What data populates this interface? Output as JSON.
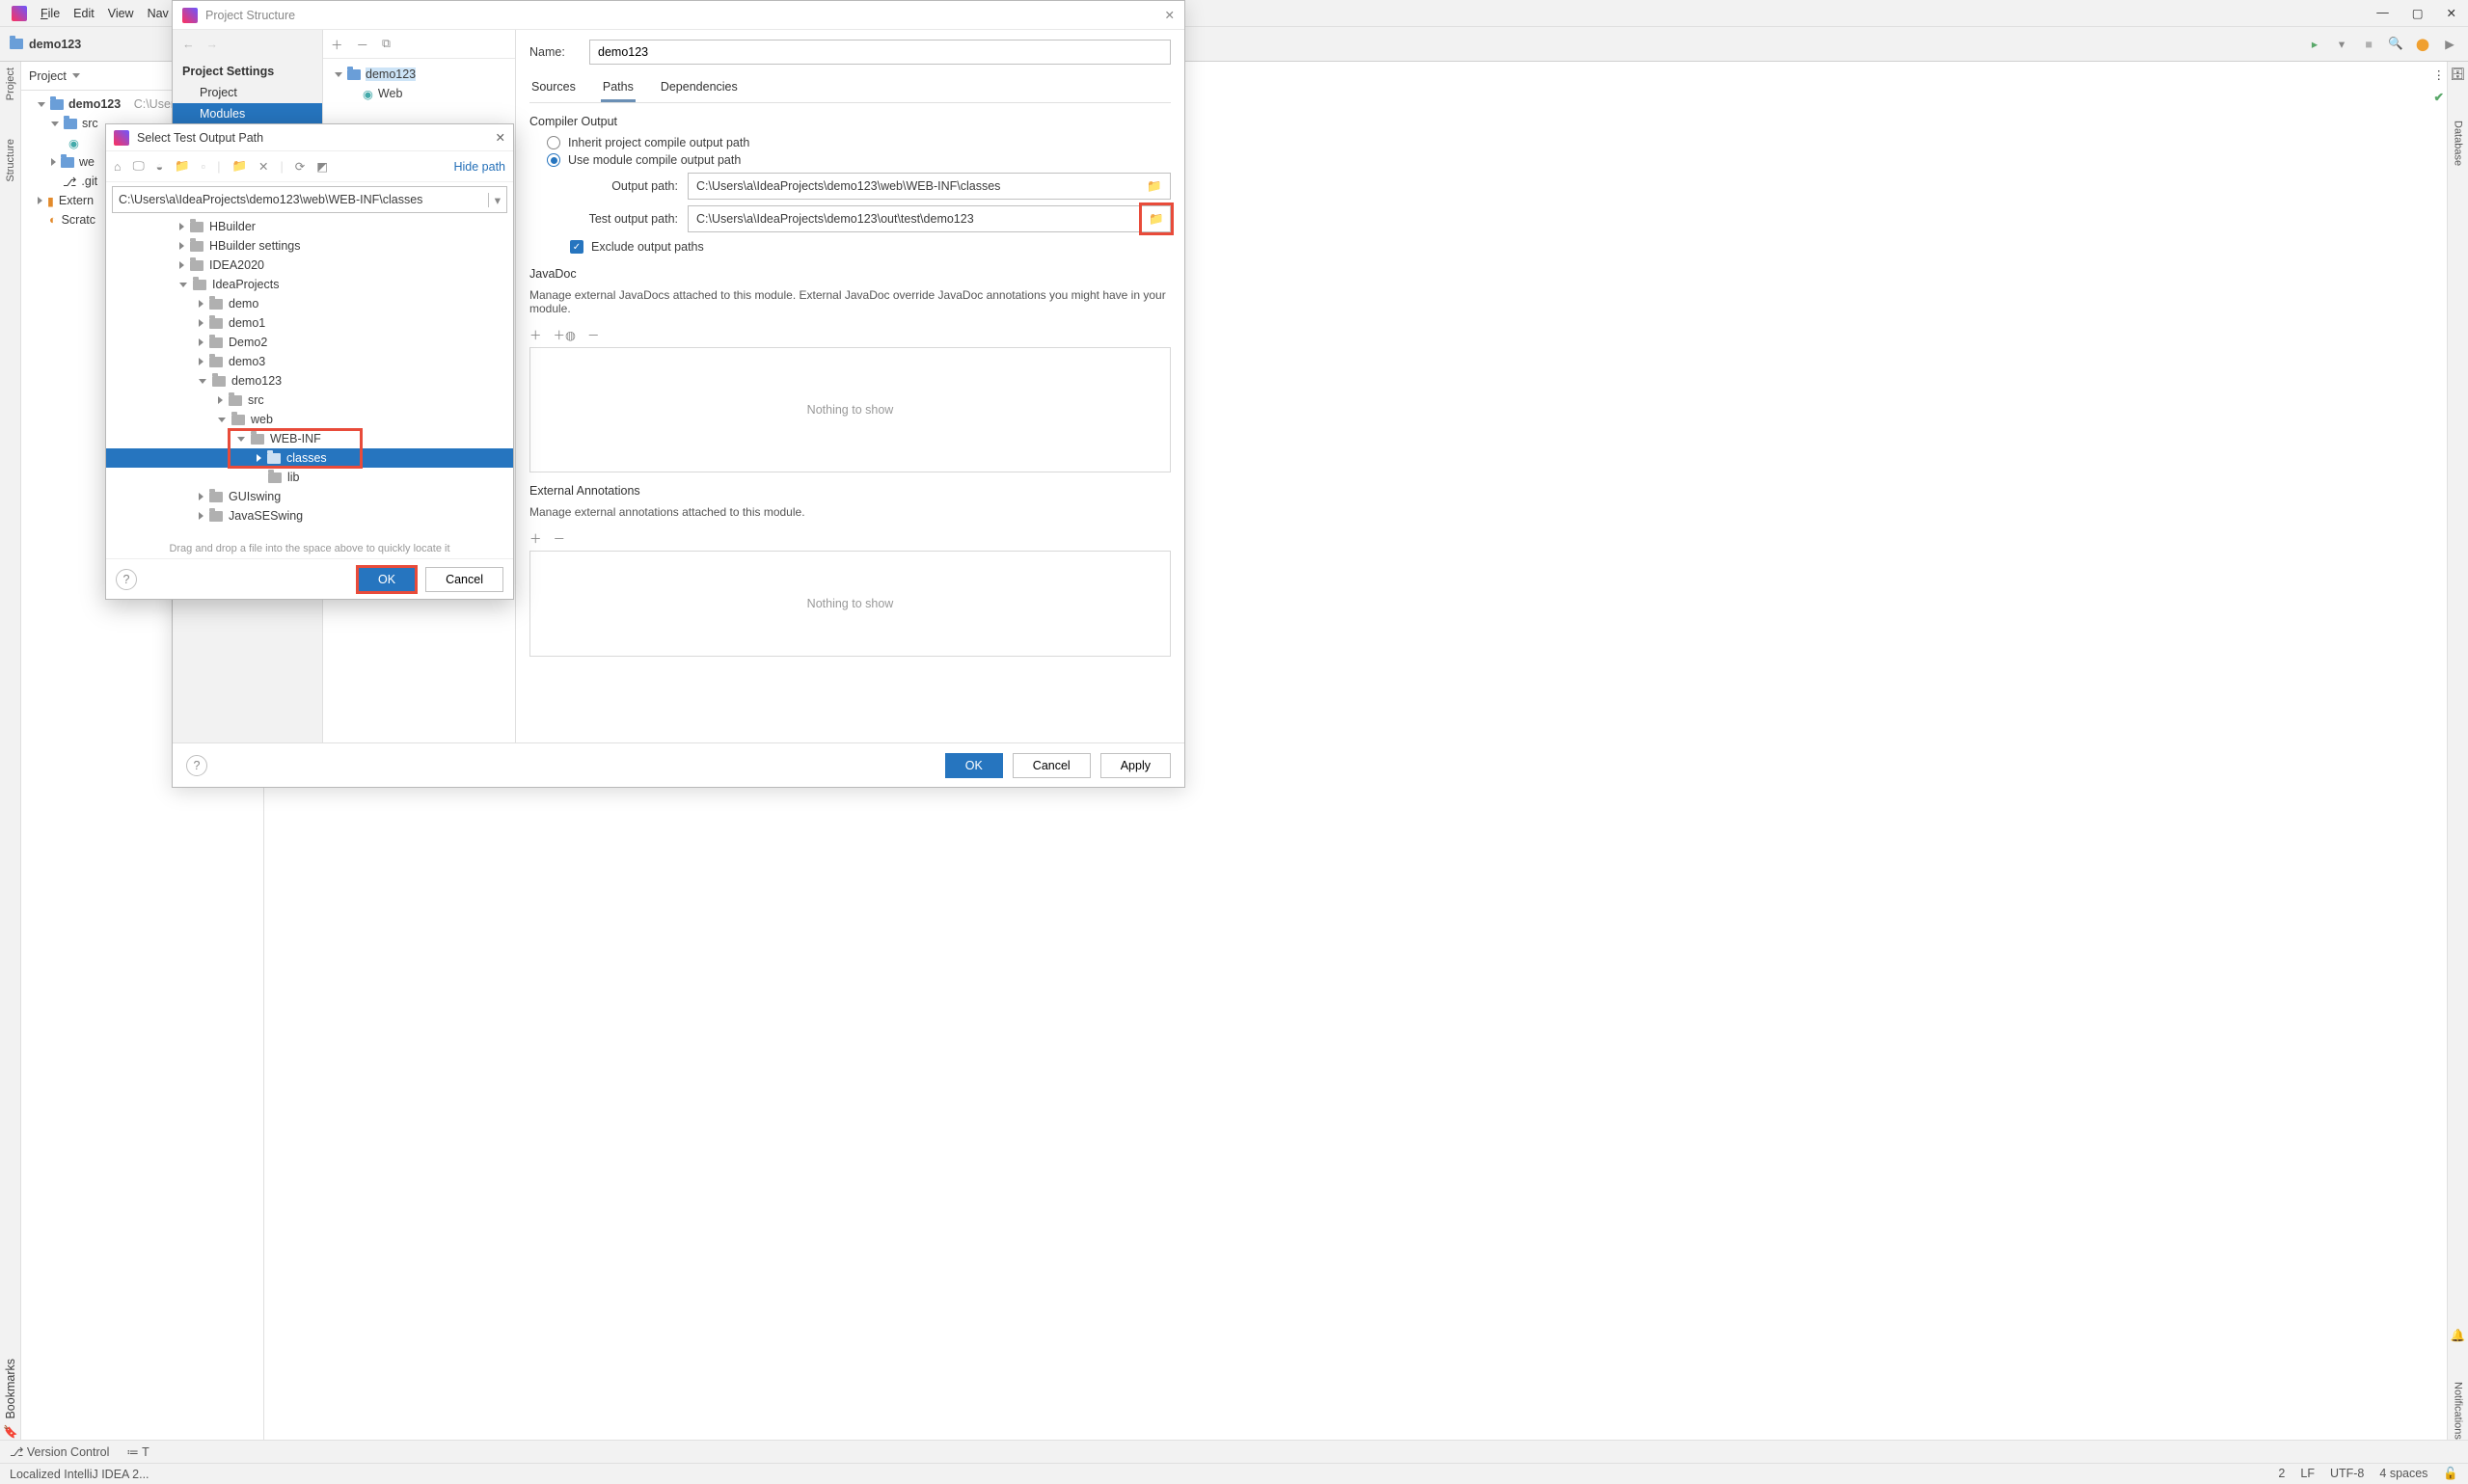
{
  "main_menu": {
    "file": "File",
    "edit": "Edit",
    "view": "View",
    "navigate": "Nav"
  },
  "nav": {
    "project_name": "demo123"
  },
  "project_pane": {
    "title": "Project",
    "root": "demo123",
    "root_path": "C:\\Users",
    "items": {
      "src": "src",
      "web": "we",
      "git": ".git",
      "external": "Extern",
      "scratch": "Scratc"
    }
  },
  "right_rail": {
    "db": "Database",
    "notif": "Notifications",
    "bookmarks": "Bookmarks"
  },
  "left_rail": {
    "project": "Project",
    "structure": "Structure"
  },
  "bottom": {
    "vcs": "Version Control",
    "t": "T"
  },
  "status": {
    "msg": "Localized IntelliJ IDEA 2...",
    "enc": "UTF-8",
    "lf": "LF",
    "indent": "4 spaces",
    "col": "2"
  },
  "ps": {
    "title": "Project Structure",
    "sidebar": {
      "settings": "Project Settings",
      "project": "Project",
      "modules": "Modules"
    },
    "module_tree": {
      "root": "demo123",
      "web": "Web"
    },
    "name_label": "Name:",
    "name_value": "demo123",
    "tabs": {
      "sources": "Sources",
      "paths": "Paths",
      "deps": "Dependencies"
    },
    "compiler": {
      "title": "Compiler Output",
      "inherit": "Inherit project compile output path",
      "use_module": "Use module compile output path",
      "output_label": "Output path:",
      "output_value": "C:\\Users\\a\\IdeaProjects\\demo123\\web\\WEB-INF\\classes",
      "test_label": "Test output path:",
      "test_value": "C:\\Users\\a\\IdeaProjects\\demo123\\out\\test\\demo123",
      "exclude": "Exclude output paths"
    },
    "javadoc": {
      "title": "JavaDoc",
      "desc": "Manage external JavaDocs attached to this module. External JavaDoc override JavaDoc annotations you might have in your module.",
      "empty": "Nothing to show"
    },
    "annotations": {
      "title": "External Annotations",
      "desc": "Manage external annotations attached to this module.",
      "empty": "Nothing to show"
    },
    "footer": {
      "ok": "OK",
      "cancel": "Cancel",
      "apply": "Apply"
    }
  },
  "sp": {
    "title": "Select Test Output Path",
    "hide_path": "Hide path",
    "path": "C:\\Users\\a\\IdeaProjects\\demo123\\web\\WEB-INF\\classes",
    "tree": {
      "hbuilder": "HBuilder",
      "hbuilder_settings": "HBuilder settings",
      "idea2020": "IDEA2020",
      "ideaprojects": "IdeaProjects",
      "demo": "demo",
      "demo1": "demo1",
      "demo2": "Demo2",
      "demo3": "demo3",
      "demo123": "demo123",
      "src": "src",
      "web": "web",
      "webinf": "WEB-INF",
      "classes": "classes",
      "lib": "lib",
      "guiswing": "GUIswing",
      "javaseswing": "JavaSESwing"
    },
    "hint": "Drag and drop a file into the space above to quickly locate it",
    "ok": "OK",
    "cancel": "Cancel"
  }
}
